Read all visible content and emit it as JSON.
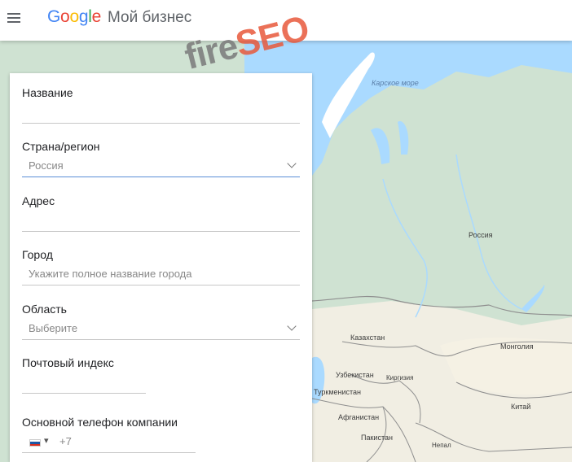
{
  "header": {
    "logo_letters": [
      {
        "ch": "G",
        "cls": "b"
      },
      {
        "ch": "o",
        "cls": "r"
      },
      {
        "ch": "o",
        "cls": "y"
      },
      {
        "ch": "g",
        "cls": "b"
      },
      {
        "ch": "l",
        "cls": "g"
      },
      {
        "ch": "e",
        "cls": "r"
      }
    ],
    "product_name": "Мой бизнес"
  },
  "watermark": {
    "part1": "fire",
    "part2": "SEO"
  },
  "form": {
    "name_label": "Название",
    "country_label": "Страна/регион",
    "country_value": "Россия",
    "address_label": "Адрес",
    "city_label": "Город",
    "city_placeholder": "Укажите полное название города",
    "region_label": "Область",
    "region_value": "Выберите",
    "zip_label": "Почтовый индекс",
    "phone_label": "Основной телефон компании",
    "phone_dropdown": "▾",
    "phone_code": "+7"
  },
  "map": {
    "labels": {
      "sea": "Карское море",
      "russia": "Россия",
      "kazakhstan": "Казахстан",
      "mongolia": "Монголия",
      "uzbekistan": "Узбекистан",
      "kyrgyzstan": "Киргизия",
      "turkmenistan": "Туркменистан",
      "afghanistan": "Афганистан",
      "pakistan": "Пакистан",
      "china": "Китай",
      "nepal": "Непал"
    },
    "colors": {
      "land": "#cfe2d2",
      "water": "#aadaff",
      "desert": "#f1eee3"
    }
  }
}
